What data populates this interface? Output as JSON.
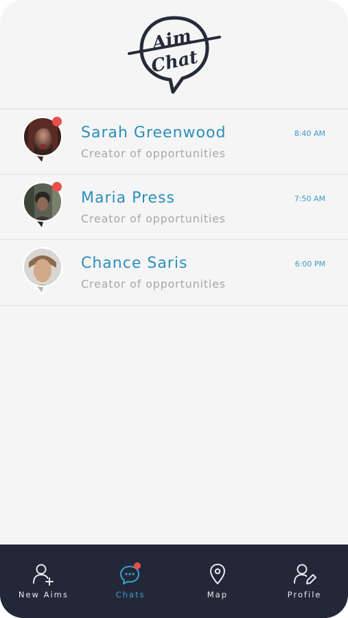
{
  "app": {
    "logo_text_line1": "Aim",
    "logo_text_line2": "Chat"
  },
  "chats": [
    {
      "name": "Sarah Greenwood",
      "subtitle": "Creator of opportunities",
      "time": "8:40 AM",
      "unread": true
    },
    {
      "name": "Maria Press",
      "subtitle": "Creator of opportunities",
      "time": "7:50 AM",
      "unread": true
    },
    {
      "name": "Chance Saris",
      "subtitle": "Creator of opportunities",
      "time": "6:00 PM",
      "unread": false
    }
  ],
  "nav": {
    "items": [
      {
        "label": "New Aims",
        "icon": "add-user-icon",
        "active": false
      },
      {
        "label": "Chats",
        "icon": "chat-bubble-icon",
        "active": true,
        "badge": true
      },
      {
        "label": "Map",
        "icon": "map-pin-icon",
        "active": false
      },
      {
        "label": "Profile",
        "icon": "edit-profile-icon",
        "active": false
      }
    ]
  },
  "colors": {
    "accent": "#2a8fb9",
    "badge": "#e94e4e",
    "navbar": "#232838",
    "background": "#f5f5f5"
  }
}
